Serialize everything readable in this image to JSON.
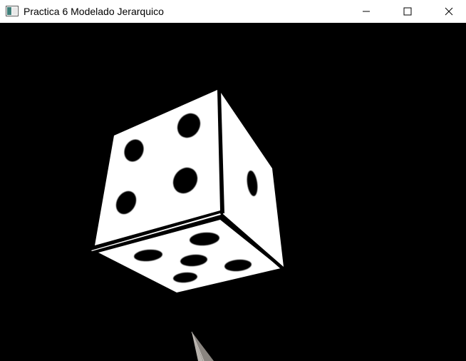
{
  "window": {
    "title": "Practica 6 Modelado Jerarquico",
    "icon": "opengl-window-icon",
    "controls": {
      "minimize": "minimize-icon",
      "maximize": "maximize-icon",
      "close": "close-icon"
    }
  },
  "scene": {
    "background_color": "#000000",
    "objects": [
      {
        "name": "die",
        "faces_visible": [
          4,
          1,
          5
        ],
        "color": "#ffffff",
        "pip_color": "#000000"
      },
      {
        "name": "gray-pyramid-tip",
        "color": "#8a8580"
      }
    ]
  }
}
